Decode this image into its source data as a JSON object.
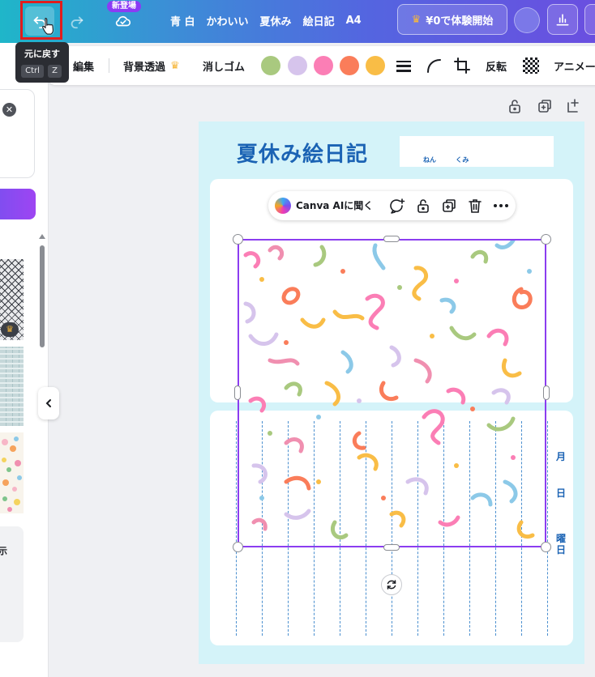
{
  "topbar": {
    "undo_label": "元に戻す",
    "redo_label": "やり直す",
    "new_badge": "新登場",
    "doc_tags": [
      "青 白",
      "かわいい",
      "夏休み",
      "絵日記",
      "A4"
    ],
    "trial_button": "¥0で体験開始",
    "colors": {
      "gradient_start": "#1fb6c9",
      "gradient_end": "#6a4fe0",
      "badge": "#8b3bf5"
    }
  },
  "tooltip": {
    "title": "元に戻す",
    "keys": [
      "Ctrl",
      "Z"
    ]
  },
  "context_toolbar": {
    "edit": "編集",
    "bg_remove": "背景透過",
    "eraser": "消しゴム",
    "color_swatches": [
      "#a9c97f",
      "#d6c4ec",
      "#fb7eb5",
      "#fa7d5a",
      "#f9bd46"
    ],
    "flip": "反転",
    "animate": "アニメー"
  },
  "side_panel": {
    "bottom_label": "示"
  },
  "page": {
    "title": "夏休み絵日記",
    "ruby_year": "ねん",
    "ruby_group": "くみ",
    "date_labels": [
      "月",
      "日",
      "曜日"
    ]
  },
  "floating_toolbar": {
    "ai_label": "Canva AIに聞く"
  },
  "selection": {
    "element": "confetti pattern image"
  }
}
